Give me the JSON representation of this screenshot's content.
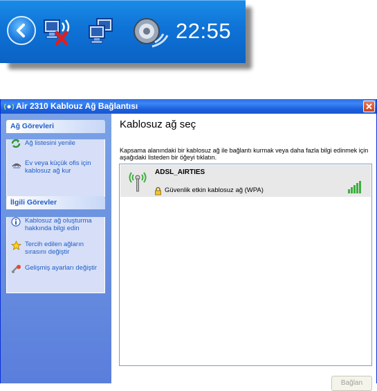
{
  "tray": {
    "time": "22:55",
    "icons": [
      "chevron-left-icon",
      "network-disconnected-icon",
      "network-connected-icon",
      "volume-icon"
    ]
  },
  "window": {
    "title": "Air 2310 Kablouz Ağ Bağlantısı",
    "taskpane": {
      "groups": [
        {
          "heading": "Ağ Görevleri",
          "tasks": [
            {
              "label": "Ağ listesini yenile",
              "icon": "refresh-icon"
            },
            {
              "label": "Ev veya küçük ofis için kablosuz ağ kur",
              "icon": "setup-network-icon"
            }
          ]
        },
        {
          "heading": "İlgili Görevler",
          "tasks": [
            {
              "label": "Kablosuz ağ oluşturma hakkında bilgi edin",
              "icon": "info-icon"
            },
            {
              "label": "Tercih edilen ağların sırasını değiştir",
              "icon": "star-icon"
            },
            {
              "label": "Gelişmiş ayarları değiştir",
              "icon": "settings-icon"
            }
          ]
        }
      ]
    },
    "main": {
      "title": "Kablosuz ağ seç",
      "description": "Kapsama alanındaki bir kablosuz ağ ile bağlantı kurmak veya daha fazla bilgi edinmek için aşağıdaki listeden bir öğeyi tıklatın.",
      "networks": [
        {
          "name": "ADSL_AIRTIES",
          "security": "Güvenlik etkin kablosuz ağ (WPA)",
          "signal": "excellent"
        }
      ],
      "connect_label": "Bağlan"
    }
  },
  "colors": {
    "taskbar": "#0e72d6",
    "titlebar": "#1c5fdc",
    "taskpane": "#6c93e0",
    "link": "#215dc6"
  }
}
